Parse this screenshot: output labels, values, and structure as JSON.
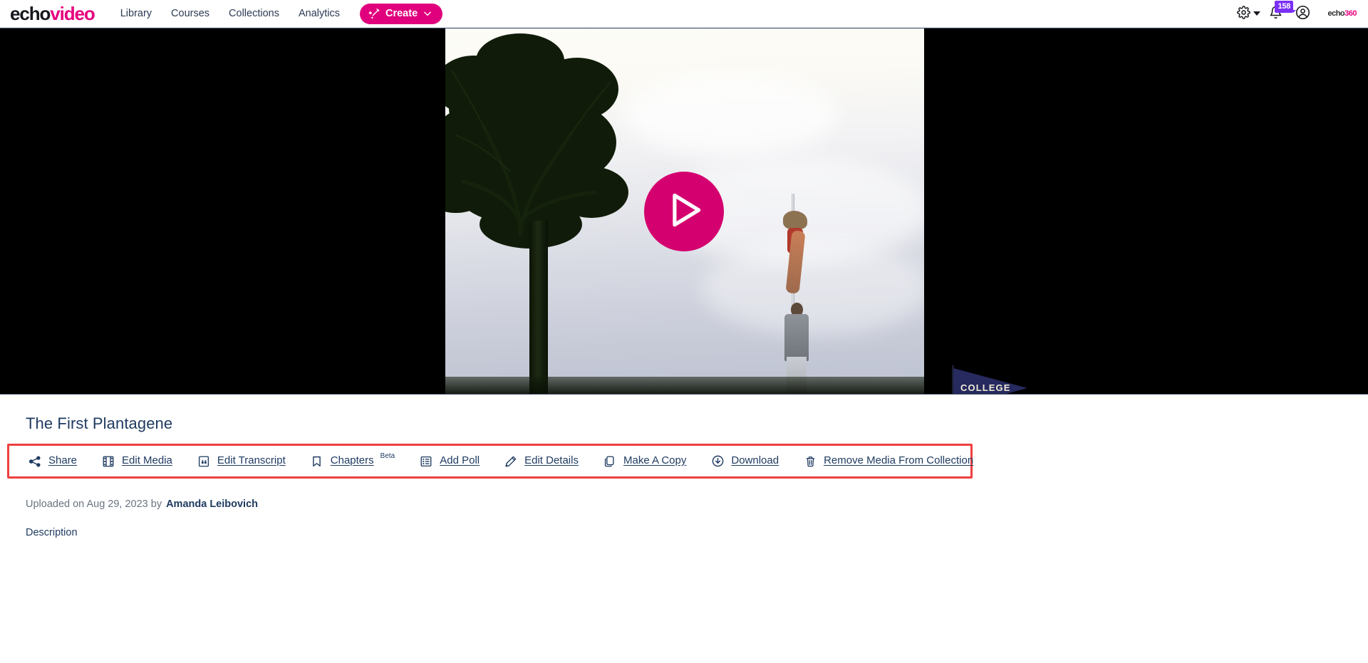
{
  "header": {
    "brand": {
      "part1": "echo",
      "part2": "video"
    },
    "nav": [
      {
        "label": "Library",
        "name": "nav-library"
      },
      {
        "label": "Courses",
        "name": "nav-courses"
      },
      {
        "label": "Collections",
        "name": "nav-collections"
      },
      {
        "label": "Analytics",
        "name": "nav-analytics"
      }
    ],
    "create_button": {
      "label": "Create",
      "icon": "magic-wand-icon",
      "chevron": "chevron-down-icon"
    },
    "right": {
      "settings_icon": "gear-icon",
      "settings_caret": "caret-down-icon",
      "notifications_icon": "bell-icon",
      "notifications_badge": "158",
      "account_icon": "user-account-icon",
      "org_logo": {
        "part1": "echo",
        "part2": "360"
      }
    },
    "colors": {
      "brand_pink": "#e6007e",
      "badge_purple": "#7b2ff7",
      "nav_text": "#2b3a52"
    }
  },
  "player": {
    "name": "video-player",
    "play_button_label": "Play",
    "play_icon": "play-triangle-icon",
    "pennant_text": "COLLEGE",
    "accent": "#d4006f"
  },
  "media": {
    "title": "The First Plantagene",
    "uploaded_prefix": "Uploaded on Aug 29, 2023 by",
    "author": "Amanda Leibovich",
    "description_label": "Description"
  },
  "actions": {
    "highlight_color": "#ef4040",
    "items": [
      {
        "label": "Share",
        "icon": "share-nodes-icon",
        "name": "action-share",
        "sup": ""
      },
      {
        "label": "Edit Media",
        "icon": "film-strip-icon",
        "name": "action-edit-media",
        "sup": ""
      },
      {
        "label": "Edit Transcript",
        "icon": "quote-icon",
        "name": "action-edit-transcript",
        "sup": ""
      },
      {
        "label": "Chapters",
        "icon": "bookmark-icon",
        "name": "action-chapters",
        "sup": "Beta"
      },
      {
        "label": "Add Poll",
        "icon": "list-icon",
        "name": "action-add-poll",
        "sup": ""
      },
      {
        "label": "Edit Details",
        "icon": "pencil-icon",
        "name": "action-edit-details",
        "sup": ""
      },
      {
        "label": "Make A Copy",
        "icon": "copy-icon",
        "name": "action-make-a-copy",
        "sup": ""
      },
      {
        "label": "Download",
        "icon": "cloud-download-icon",
        "name": "action-download",
        "sup": ""
      },
      {
        "label": "Remove Media From Collection",
        "icon": "trash-icon",
        "name": "action-remove-media",
        "sup": ""
      }
    ]
  }
}
